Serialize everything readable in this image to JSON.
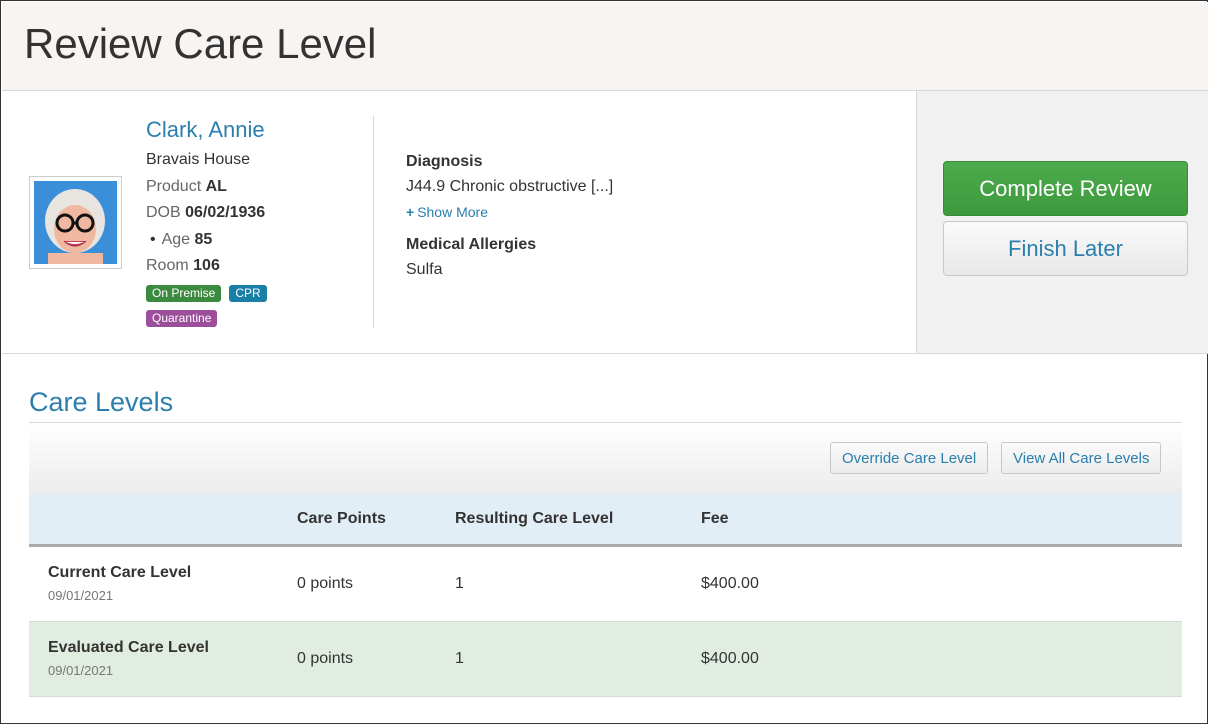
{
  "page": {
    "title": "Review Care Level"
  },
  "resident": {
    "name": "Clark, Annie",
    "facility": "Bravais House",
    "product_label": "Product",
    "product": "AL",
    "dob_label": "DOB",
    "dob": "06/02/1936",
    "age_label": "Age",
    "age": "85",
    "room_label": "Room",
    "room": "106",
    "badges": [
      {
        "label": "On Premise",
        "color": "#3c8a3f"
      },
      {
        "label": "CPR",
        "color": "#1a7fa6"
      },
      {
        "label": "Quarantine",
        "color": "#9b4f9b"
      }
    ]
  },
  "clinical": {
    "diagnosis_label": "Diagnosis",
    "diagnosis": "J44.9 Chronic obstructive [...]",
    "show_more": "Show More",
    "allergies_label": "Medical Allergies",
    "allergies": "Sulfa"
  },
  "actions": {
    "complete": "Complete Review",
    "finish_later": "Finish Later"
  },
  "care_levels": {
    "title": "Care Levels",
    "override_button": "Override Care Level",
    "view_all_button": "View All Care Levels",
    "columns": [
      "",
      "Care Points",
      "Resulting Care Level",
      "Fee"
    ],
    "rows": [
      {
        "label": "Current Care Level",
        "date": "09/01/2021",
        "points": "0 points",
        "level": "1",
        "fee": "$400.00"
      },
      {
        "label": "Evaluated Care Level",
        "date": "09/01/2021",
        "points": "0 points",
        "level": "1",
        "fee": "$400.00"
      }
    ]
  },
  "colors": {
    "accent": "#2a7fad",
    "primary_button": "#3d993d",
    "evaluated_row": "#e0ede0",
    "table_header": "#e2eef5"
  }
}
